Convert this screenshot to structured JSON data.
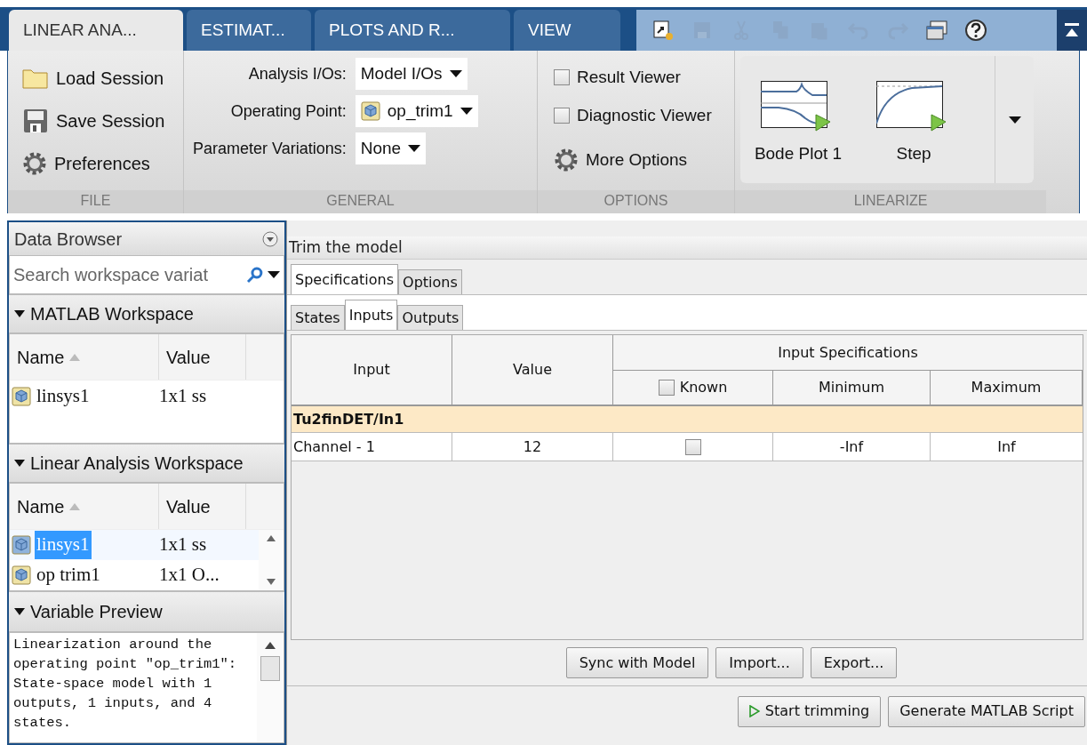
{
  "ribbon_tabs": [
    {
      "label": "LINEAR ANA...",
      "selected": true
    },
    {
      "label": "ESTIMAT...",
      "selected": false
    },
    {
      "label": "PLOTS AND R...",
      "selected": false
    },
    {
      "label": "VIEW",
      "selected": false
    }
  ],
  "quick_access": [
    {
      "kind": "new",
      "disabled": false
    },
    {
      "kind": "save",
      "disabled": true
    },
    {
      "kind": "cut",
      "disabled": true
    },
    {
      "kind": "copy",
      "disabled": true
    },
    {
      "kind": "paste",
      "disabled": true
    },
    {
      "kind": "undo",
      "disabled": true
    },
    {
      "kind": "redo",
      "disabled": true
    },
    {
      "kind": "windows",
      "disabled": false
    },
    {
      "kind": "help",
      "disabled": false
    }
  ],
  "file_section": {
    "label": "FILE",
    "buttons": [
      {
        "kind": "folder",
        "label": "Load Session"
      },
      {
        "kind": "save",
        "label": "Save Session"
      },
      {
        "kind": "gear",
        "label": "Preferences"
      }
    ]
  },
  "general_section": {
    "label": "GENERAL",
    "fields": [
      {
        "label": "Analysis I/Os:",
        "value": "Model I/Os",
        "icon": false
      },
      {
        "label": "Operating Point:",
        "value": "op_trim1",
        "icon": true
      },
      {
        "label": "Parameter Variations:",
        "value": "None",
        "icon": false
      }
    ]
  },
  "options_section": {
    "label": "OPTIONS",
    "checkboxes": [
      {
        "label": "Result Viewer",
        "checked": false
      },
      {
        "label": "Diagnostic Viewer",
        "checked": false
      }
    ],
    "more": "More Options"
  },
  "linearize_section": {
    "label": "LINEARIZE",
    "plots": [
      {
        "kind": "bode",
        "label": "Bode Plot 1"
      },
      {
        "kind": "step",
        "label": "Step"
      }
    ]
  },
  "data_browser": {
    "title": "Data Browser",
    "search_placeholder": "Search workspace variat",
    "sections": [
      {
        "title": "MATLAB Workspace",
        "columns": [
          "Name",
          "Value"
        ],
        "scroll": false,
        "rows": [
          {
            "name": "linsys1",
            "value": "1x1 ss",
            "selected": false
          }
        ]
      },
      {
        "title": "Linear Analysis Workspace",
        "columns": [
          "Name",
          "Value"
        ],
        "scroll": true,
        "rows": [
          {
            "name": "linsys1",
            "value": "1x1 ss",
            "selected": true
          },
          {
            "name": "op trim1",
            "value": "1x1 O...",
            "selected": false
          }
        ]
      }
    ],
    "preview_title": "Variable Preview",
    "preview_text": "Linearization around the operating point \"op_trim1\": State-space model with 1 outputs, 1 inputs, and 4 states."
  },
  "trim_panel": {
    "title": "Trim the model",
    "tabs": [
      {
        "label": "Specifications",
        "selected": true
      },
      {
        "label": "Options",
        "selected": false
      }
    ],
    "subtabs": [
      {
        "label": "States",
        "selected": false
      },
      {
        "label": "Inputs",
        "selected": true
      },
      {
        "label": "Outputs",
        "selected": false
      }
    ],
    "table": {
      "columns": [
        "Input",
        "Value"
      ],
      "group_header": "Input Specifications",
      "known_label": "Known",
      "known_checked": false,
      "sub_columns": [
        "Minimum",
        "Maximum"
      ],
      "groups": [
        {
          "name": "Tu2finDET/In1",
          "rows": [
            {
              "input": "Channel - 1",
              "value": "12",
              "known": false,
              "minimum": "-Inf",
              "maximum": "Inf"
            }
          ]
        }
      ]
    },
    "buttons": [
      "Sync with Model",
      "Import...",
      "Export..."
    ],
    "actions": [
      {
        "label": "Start trimming",
        "kind": "run"
      },
      {
        "label": "Generate MATLAB Script",
        "kind": "plain"
      }
    ]
  }
}
